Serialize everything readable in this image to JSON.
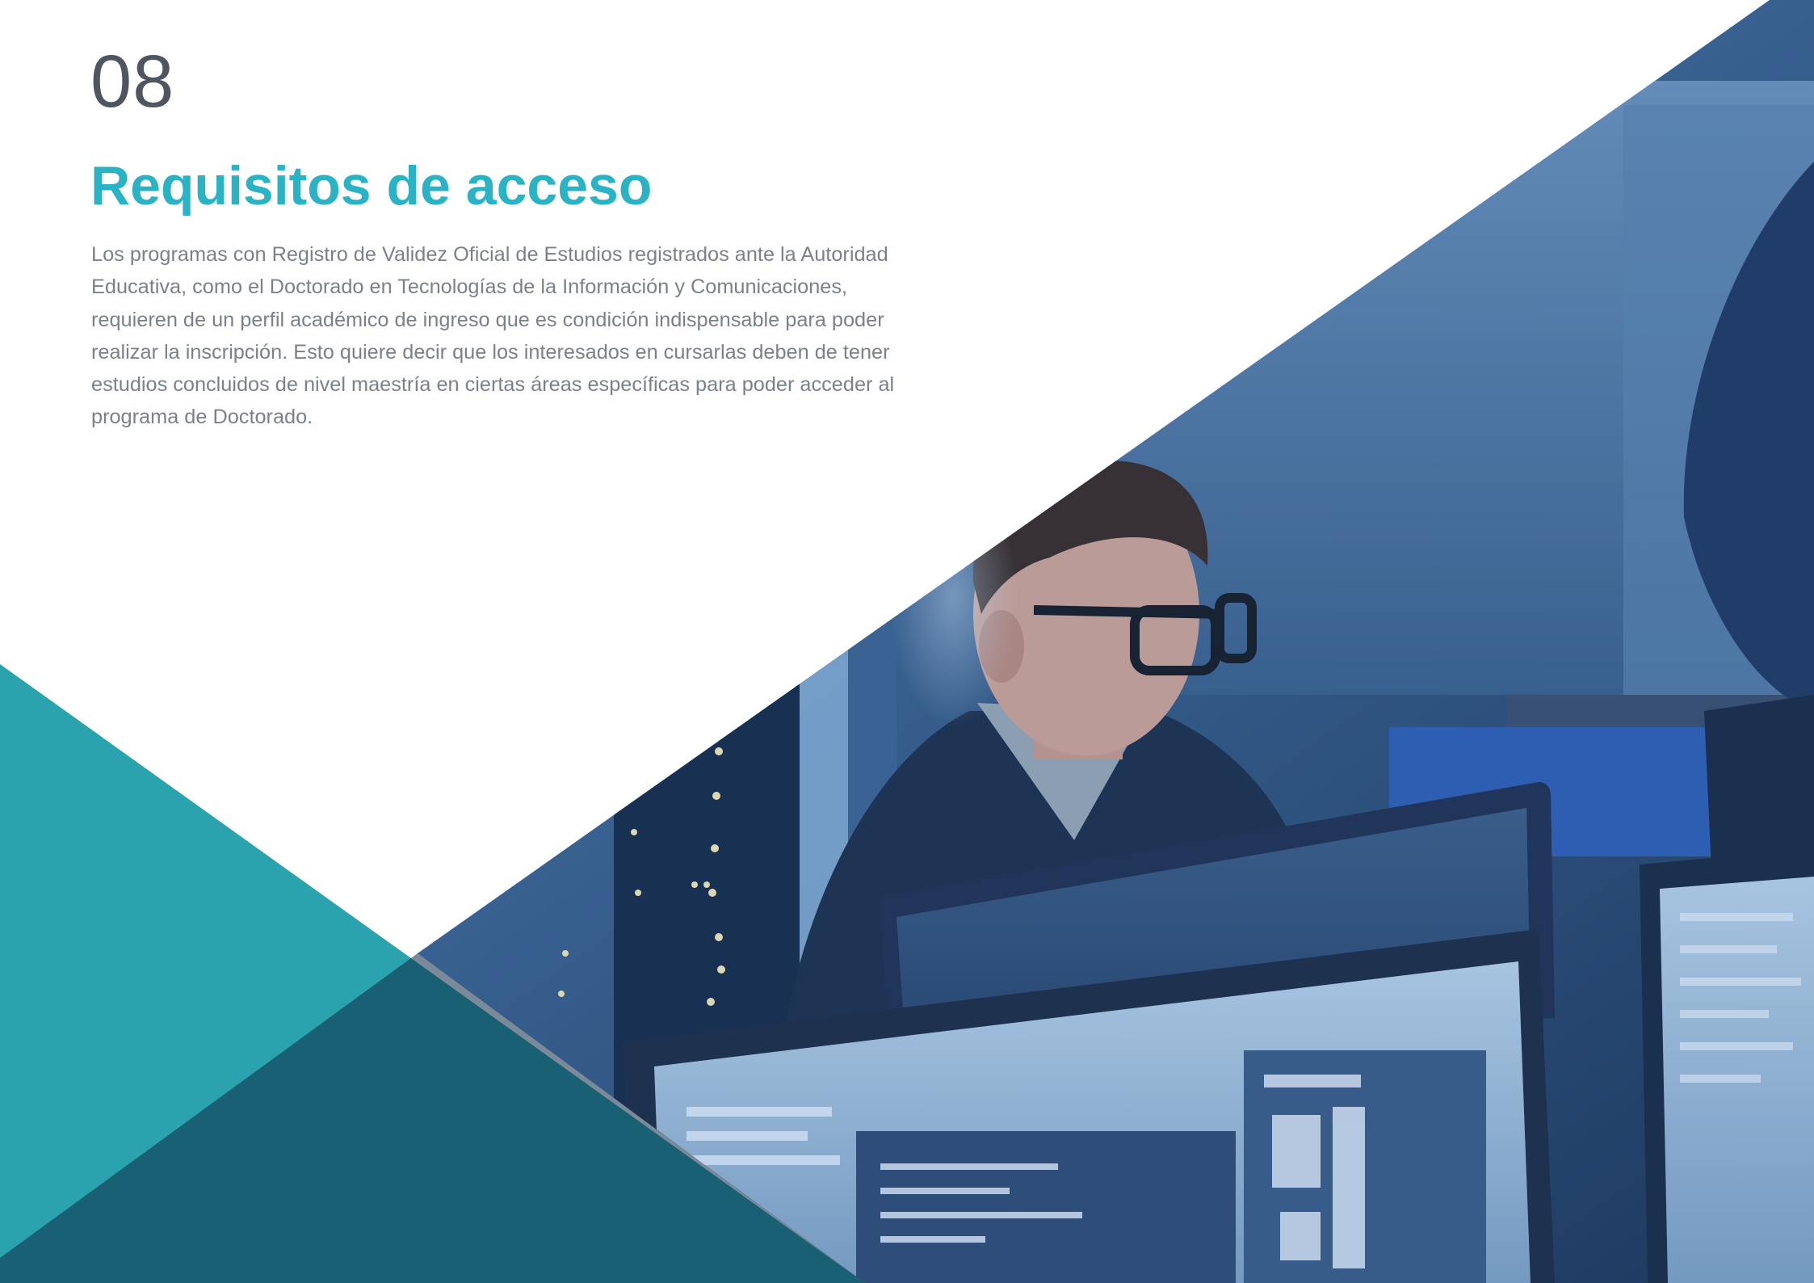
{
  "section": {
    "number": "08",
    "title": "Requisitos de acceso",
    "body": "Los programas con Registro de Validez Oficial de Estudios registrados ante la Autoridad Educativa, como el Doctorado en Tecnologías de la Información y Comunicaciones, requieren de un perfil académico de ingreso que es condición indispensable para poder realizar la inscripción. Esto quiere decir que los interesados en cursarlas deben de tener estudios concluidos de nivel maestría en ciertas áreas específicas para poder acceder al programa de Doctorado."
  },
  "colors": {
    "accent": "#2ab3c5",
    "teal_shape": "#2aa3ae",
    "number_text": "#4f5661",
    "body_text": "#7b818a"
  }
}
